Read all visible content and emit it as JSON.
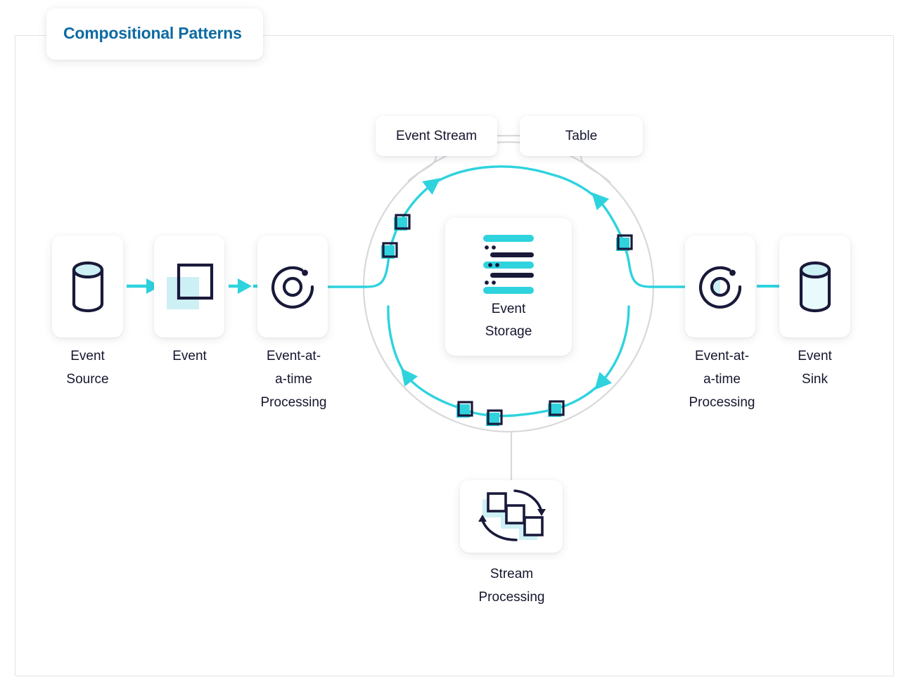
{
  "title": {
    "text": "Compositional Patterns",
    "color": "#0e6ba1"
  },
  "colors": {
    "cyan": "#2ed3de",
    "cyan_light": "#c9f0f5",
    "navy": "#19193a",
    "gray_line": "#d8d9db",
    "frame_border": "#e2e3e5",
    "card_bg": "#ffffff",
    "text": "#15162e"
  },
  "nodes": {
    "event_source": {
      "label": "Event\nSource",
      "label_line1": "Event",
      "label_line2": "Source",
      "icon": "database-cylinder-icon"
    },
    "event": {
      "label": "Event",
      "label_line1": "Event",
      "label_line2": "",
      "icon": "event-square-icon"
    },
    "processing_left": {
      "label_line1": "Event-at-",
      "label_line2": "a-time",
      "label_line3": "Processing",
      "icon": "event-at-a-time-processing-icon"
    },
    "processing_right": {
      "label_line1": "Event-at-",
      "label_line2": "a-time",
      "label_line3": "Processing",
      "icon": "event-at-a-time-processing-icon"
    },
    "event_sink": {
      "label_line1": "Event",
      "label_line2": "Sink",
      "icon": "database-cylinder-icon"
    },
    "event_storage": {
      "label_line1": "Event",
      "label_line2": "Storage",
      "icon": "event-storage-log-icon"
    },
    "stream_processing": {
      "label_line1": "Stream",
      "label_line2": "Processing",
      "icon": "stream-processing-icon"
    },
    "event_stream": {
      "label": "Event Stream"
    },
    "table": {
      "label": "Table"
    }
  }
}
